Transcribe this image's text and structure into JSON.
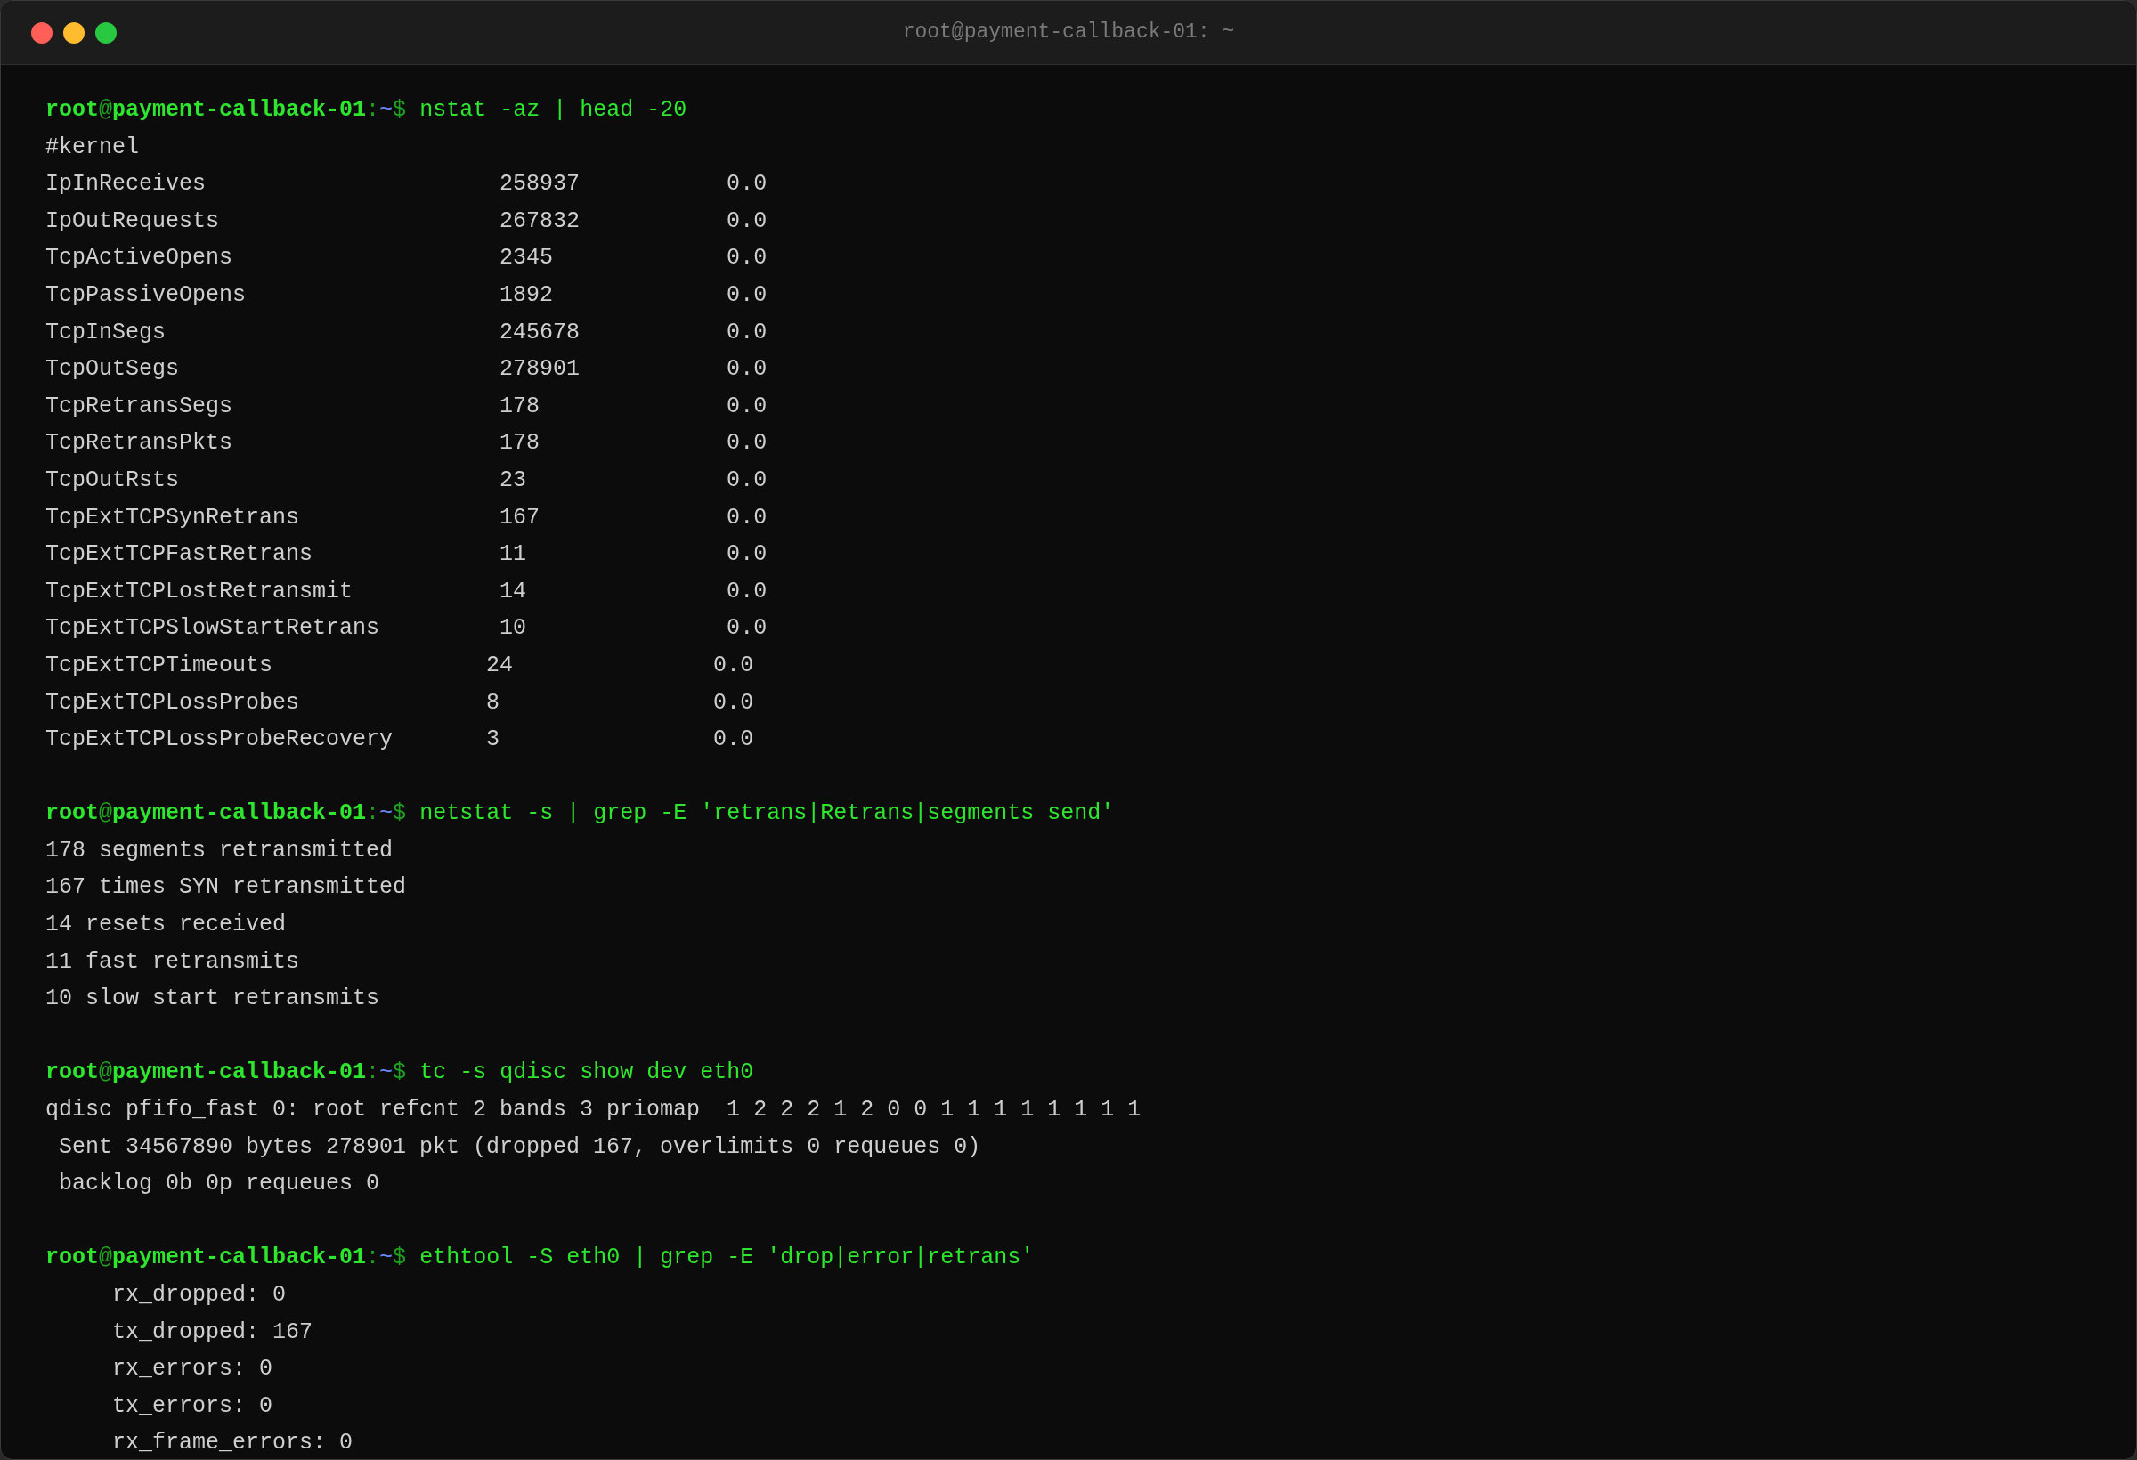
{
  "window": {
    "title": "root@payment-callback-01: ~"
  },
  "sessions": [
    {
      "prompt": {
        "user": "root",
        "at": "@",
        "host": "payment-callback-01",
        "sep": ":",
        "path": "~",
        "symbol": "$"
      },
      "command": "nstat -az | head -20",
      "output": [
        "#kernel",
        "IpInReceives                      258937           0.0",
        "IpOutRequests                     267832           0.0",
        "TcpActiveOpens                    2345             0.0",
        "TcpPassiveOpens                   1892             0.0",
        "TcpInSegs                         245678           0.0",
        "TcpOutSegs                        278901           0.0",
        "TcpRetransSegs                    178              0.0",
        "TcpRetransPkts                    178              0.0",
        "TcpOutRsts                        23               0.0",
        "TcpExtTCPSynRetrans               167              0.0",
        "TcpExtTCPFastRetrans              11               0.0",
        "TcpExtTCPLostRetransmit           14               0.0",
        "TcpExtTCPSlowStartRetrans         10               0.0",
        "TcpExtTCPTimeouts                24               0.0",
        "TcpExtTCPLossProbes              8                0.0",
        "TcpExtTCPLossProbeRecovery       3                0.0"
      ]
    },
    {
      "prompt": {
        "user": "root",
        "at": "@",
        "host": "payment-callback-01",
        "sep": ":",
        "path": "~",
        "symbol": "$"
      },
      "command": "netstat -s | grep -E 'retrans|Retrans|segments send'",
      "output": [
        "178 segments retransmitted",
        "167 times SYN retransmitted",
        "14 resets received",
        "11 fast retransmits",
        "10 slow start retransmits"
      ]
    },
    {
      "prompt": {
        "user": "root",
        "at": "@",
        "host": "payment-callback-01",
        "sep": ":",
        "path": "~",
        "symbol": "$"
      },
      "command": "tc -s qdisc show dev eth0",
      "output": [
        "qdisc pfifo_fast 0: root refcnt 2 bands 3 priomap  1 2 2 2 1 2 0 0 1 1 1 1 1 1 1 1",
        " Sent 34567890 bytes 278901 pkt (dropped 167, overlimits 0 requeues 0)",
        " backlog 0b 0p requeues 0"
      ]
    },
    {
      "prompt": {
        "user": "root",
        "at": "@",
        "host": "payment-callback-01",
        "sep": ":",
        "path": "~",
        "symbol": "$"
      },
      "command": "ethtool -S eth0 | grep -E 'drop|error|retrans'",
      "output": [
        "     rx_dropped: 0",
        "     tx_dropped: 167",
        "     rx_errors: 0",
        "     tx_errors: 0",
        "     rx_frame_errors: 0"
      ]
    }
  ]
}
